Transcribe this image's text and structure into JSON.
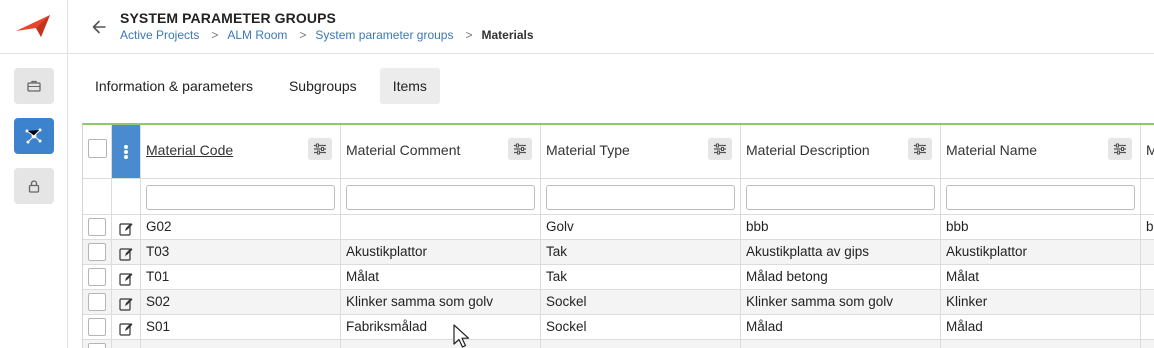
{
  "header": {
    "title": "SYSTEM PARAMETER GROUPS",
    "breadcrumb": [
      "Active Projects",
      "ALM Room",
      "System parameter groups"
    ],
    "breadcrumb_current": "Materials",
    "separator": ">"
  },
  "sidebar": {
    "items": [
      {
        "icon": "briefcase-icon",
        "active": false
      },
      {
        "icon": "network-icon",
        "active": true
      },
      {
        "icon": "lock-icon",
        "active": false
      }
    ]
  },
  "tabs": [
    {
      "label": "Information & parameters",
      "active": false
    },
    {
      "label": "Subgroups",
      "active": false
    },
    {
      "label": "Items",
      "active": true
    }
  ],
  "grid": {
    "columns": [
      {
        "label": "Material Code",
        "underline": true
      },
      {
        "label": "Material Comment",
        "underline": false
      },
      {
        "label": "Material Type",
        "underline": false
      },
      {
        "label": "Material Description",
        "underline": false
      },
      {
        "label": "Material Name",
        "underline": false
      },
      {
        "label": "M",
        "underline": false
      }
    ],
    "rows": [
      [
        "G02",
        "",
        "Golv",
        "bbb",
        "bbb",
        "b"
      ],
      [
        "T03",
        "Akustikplattor",
        "Tak",
        "Akustikplatta av gips",
        "Akustikplattor",
        ""
      ],
      [
        "T01",
        "Målat",
        "Tak",
        "Målad betong",
        "Målat",
        ""
      ],
      [
        "S02",
        "Klinker samma som golv",
        "Sockel",
        "Klinker samma som golv",
        "Klinker",
        ""
      ],
      [
        "S01",
        "Fabriksmålad",
        "Sockel",
        "Målad",
        "Målad",
        ""
      ]
    ]
  },
  "colors": {
    "accent": "#3d82cc",
    "link": "#3b78b5",
    "logo": "#e8452c",
    "grid_top_border": "#8fc96c"
  }
}
